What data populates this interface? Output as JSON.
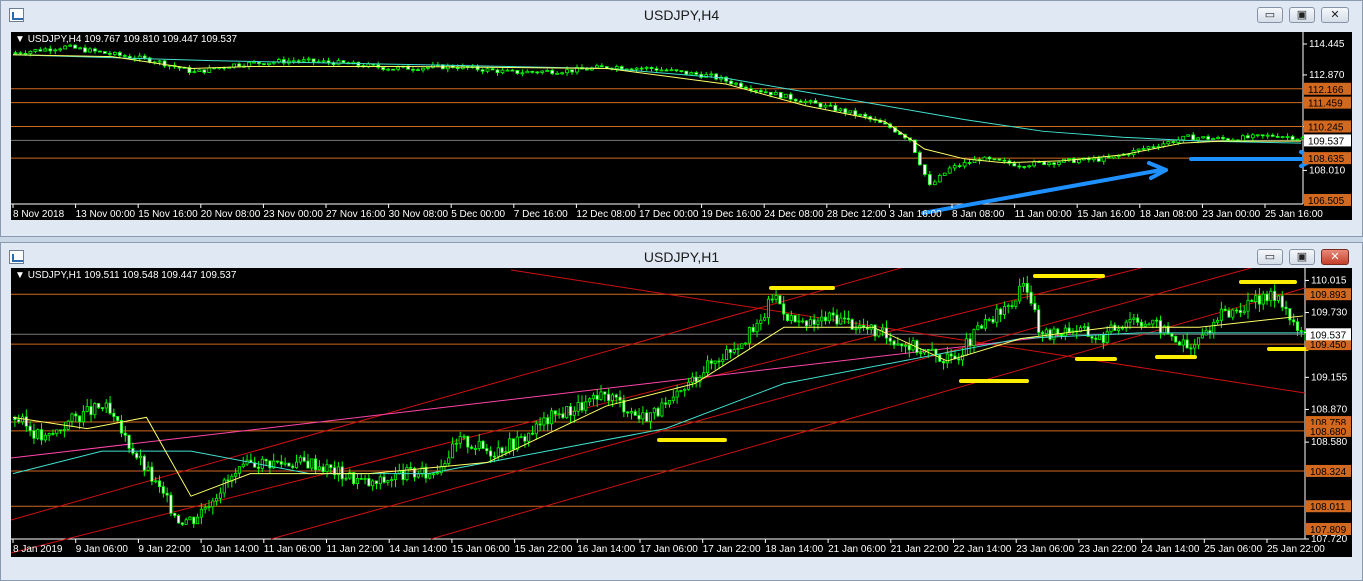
{
  "windows": [
    {
      "title": "USDJPY,H4",
      "symbol_line": "USDJPY,H4  109.767 109.810 109.447 109.537",
      "buttons": {
        "minimize": "▭",
        "restore": "▣",
        "close": "✕"
      }
    },
    {
      "title": "USDJPY,H1",
      "symbol_line": "USDJPY,H1  109.511 109.548 109.447 109.537",
      "buttons": {
        "minimize": "▭",
        "restore": "▣",
        "close": "✕"
      }
    }
  ],
  "chart_data": [
    {
      "type": "candlestick",
      "title": "USDJPY,H4",
      "x_ticks": [
        "8 Nov 2018",
        "13 Nov 00:00",
        "15 Nov 16:00",
        "20 Nov 08:00",
        "23 Nov 00:00",
        "27 Nov 16:00",
        "30 Nov 08:00",
        "5 Dec 00:00",
        "7 Dec 16:00",
        "12 Dec 08:00",
        "17 Dec 00:00",
        "19 Dec 16:00",
        "24 Dec 08:00",
        "28 Dec 12:00",
        "3 Jan 16:00",
        "8 Jan 08:00",
        "11 Jan 00:00",
        "15 Jan 16:00",
        "18 Jan 08:00",
        "23 Jan 00:00",
        "25 Jan 16:00"
      ],
      "y_ticks": [
        114.445,
        112.87,
        110.245,
        108.01
      ],
      "ylim": [
        106.3,
        114.75
      ],
      "current_price": 109.537,
      "price_boxes": [
        112.166,
        111.459,
        110.245,
        108.635,
        106.505
      ],
      "horizontal_levels": [
        112.166,
        111.459,
        110.245,
        109.537,
        108.635
      ],
      "close_path": [
        [
          0,
          114.0
        ],
        [
          5,
          114.3
        ],
        [
          10,
          113.9
        ],
        [
          14,
          113.6
        ],
        [
          18,
          113.0
        ],
        [
          22,
          113.4
        ],
        [
          28,
          113.6
        ],
        [
          32,
          113.5
        ],
        [
          38,
          113.2
        ],
        [
          44,
          113.3
        ],
        [
          50,
          113.0
        ],
        [
          56,
          113.1
        ],
        [
          60,
          113.3
        ],
        [
          64,
          113.2
        ],
        [
          70,
          112.8
        ],
        [
          74,
          112.2
        ],
        [
          78,
          111.7
        ],
        [
          82,
          111.2
        ],
        [
          85,
          110.8
        ],
        [
          88,
          110.2
        ],
        [
          90,
          109.6
        ],
        [
          92,
          107.2
        ],
        [
          94,
          108.1
        ],
        [
          97,
          108.6
        ],
        [
          101,
          108.3
        ],
        [
          106,
          108.5
        ],
        [
          110,
          108.6
        ],
        [
          114,
          109.2
        ],
        [
          118,
          109.7
        ],
        [
          122,
          109.6
        ],
        [
          127,
          109.8
        ],
        [
          130,
          109.6
        ]
      ],
      "ma_slow_path": [
        [
          0,
          113.9
        ],
        [
          20,
          113.6
        ],
        [
          40,
          113.4
        ],
        [
          60,
          113.2
        ],
        [
          72,
          112.7
        ],
        [
          80,
          112.0
        ],
        [
          88,
          111.3
        ],
        [
          96,
          110.6
        ],
        [
          104,
          110.0
        ],
        [
          112,
          109.7
        ],
        [
          120,
          109.5
        ],
        [
          130,
          109.4
        ]
      ],
      "ma_fast_path": [
        [
          0,
          113.9
        ],
        [
          10,
          113.8
        ],
        [
          18,
          113.2
        ],
        [
          24,
          113.3
        ],
        [
          40,
          113.3
        ],
        [
          60,
          113.2
        ],
        [
          72,
          112.4
        ],
        [
          80,
          111.3
        ],
        [
          88,
          110.5
        ],
        [
          92,
          109.1
        ],
        [
          96,
          108.6
        ],
        [
          100,
          108.4
        ],
        [
          106,
          108.5
        ],
        [
          112,
          108.8
        ],
        [
          118,
          109.4
        ],
        [
          122,
          109.5
        ],
        [
          130,
          109.5
        ]
      ]
    },
    {
      "type": "candlestick",
      "title": "USDJPY,H1",
      "x_ticks": [
        "8 Jan 2019",
        "9 Jan 06:00",
        "9 Jan 22:00",
        "10 Jan 14:00",
        "11 Jan 06:00",
        "11 Jan 22:00",
        "14 Jan 14:00",
        "15 Jan 06:00",
        "15 Jan 22:00",
        "16 Jan 14:00",
        "17 Jan 06:00",
        "17 Jan 22:00",
        "18 Jan 14:00",
        "21 Jan 06:00",
        "21 Jan 22:00",
        "22 Jan 14:00",
        "23 Jan 06:00",
        "23 Jan 22:00",
        "24 Jan 14:00",
        "25 Jan 06:00",
        "25 Jan 22:00"
      ],
      "y_ticks": [
        110.015,
        109.73,
        109.155,
        108.87,
        108.58,
        107.72
      ],
      "ylim": [
        107.72,
        110.09
      ],
      "current_price": 109.537,
      "price_boxes": [
        109.893,
        109.45,
        108.758,
        108.68,
        108.324,
        108.011,
        107.809
      ],
      "horizontal_levels": [
        109.893,
        109.537,
        109.45,
        108.758,
        108.68,
        108.324,
        108.011
      ],
      "close_path": [
        [
          0,
          108.8
        ],
        [
          2,
          108.6
        ],
        [
          4,
          108.8
        ],
        [
          6,
          108.9
        ],
        [
          7,
          108.7
        ],
        [
          9,
          108.3
        ],
        [
          11,
          107.9
        ],
        [
          12,
          107.9
        ],
        [
          14,
          108.2
        ],
        [
          16,
          108.4
        ],
        [
          18,
          108.4
        ],
        [
          20,
          108.4
        ],
        [
          22,
          108.3
        ],
        [
          24,
          108.2
        ],
        [
          26,
          108.3
        ],
        [
          28,
          108.3
        ],
        [
          30,
          108.6
        ],
        [
          32,
          108.5
        ],
        [
          34,
          108.6
        ],
        [
          36,
          108.8
        ],
        [
          38,
          108.9
        ],
        [
          40,
          109.0
        ],
        [
          42,
          108.8
        ],
        [
          44,
          108.9
        ],
        [
          46,
          109.2
        ],
        [
          48,
          109.4
        ],
        [
          50,
          109.6
        ],
        [
          51,
          109.9
        ],
        [
          52,
          109.7
        ],
        [
          53,
          109.6
        ],
        [
          55,
          109.7
        ],
        [
          57,
          109.6
        ],
        [
          59,
          109.5
        ],
        [
          61,
          109.4
        ],
        [
          63,
          109.3
        ],
        [
          65,
          109.6
        ],
        [
          67,
          109.8
        ],
        [
          68,
          110.0
        ],
        [
          69,
          109.5
        ],
        [
          71,
          109.6
        ],
        [
          73,
          109.5
        ],
        [
          75,
          109.7
        ],
        [
          77,
          109.6
        ],
        [
          79,
          109.4
        ],
        [
          81,
          109.7
        ],
        [
          83,
          109.8
        ],
        [
          85,
          109.9
        ],
        [
          86,
          109.6
        ],
        [
          87,
          109.5
        ]
      ],
      "ma_slow_path": [
        [
          0,
          108.3
        ],
        [
          6,
          108.5
        ],
        [
          12,
          108.5
        ],
        [
          20,
          108.3
        ],
        [
          28,
          108.3
        ],
        [
          36,
          108.5
        ],
        [
          44,
          108.7
        ],
        [
          52,
          109.1
        ],
        [
          60,
          109.3
        ],
        [
          68,
          109.5
        ],
        [
          76,
          109.55
        ],
        [
          87,
          109.55
        ]
      ],
      "ma_fast_path": [
        [
          0,
          108.8
        ],
        [
          5,
          108.7
        ],
        [
          9,
          108.8
        ],
        [
          12,
          108.1
        ],
        [
          16,
          108.3
        ],
        [
          24,
          108.3
        ],
        [
          32,
          108.4
        ],
        [
          40,
          108.9
        ],
        [
          46,
          109.1
        ],
        [
          52,
          109.6
        ],
        [
          58,
          109.6
        ],
        [
          63,
          109.3
        ],
        [
          68,
          109.5
        ],
        [
          74,
          109.6
        ],
        [
          80,
          109.6
        ],
        [
          87,
          109.7
        ]
      ]
    }
  ]
}
